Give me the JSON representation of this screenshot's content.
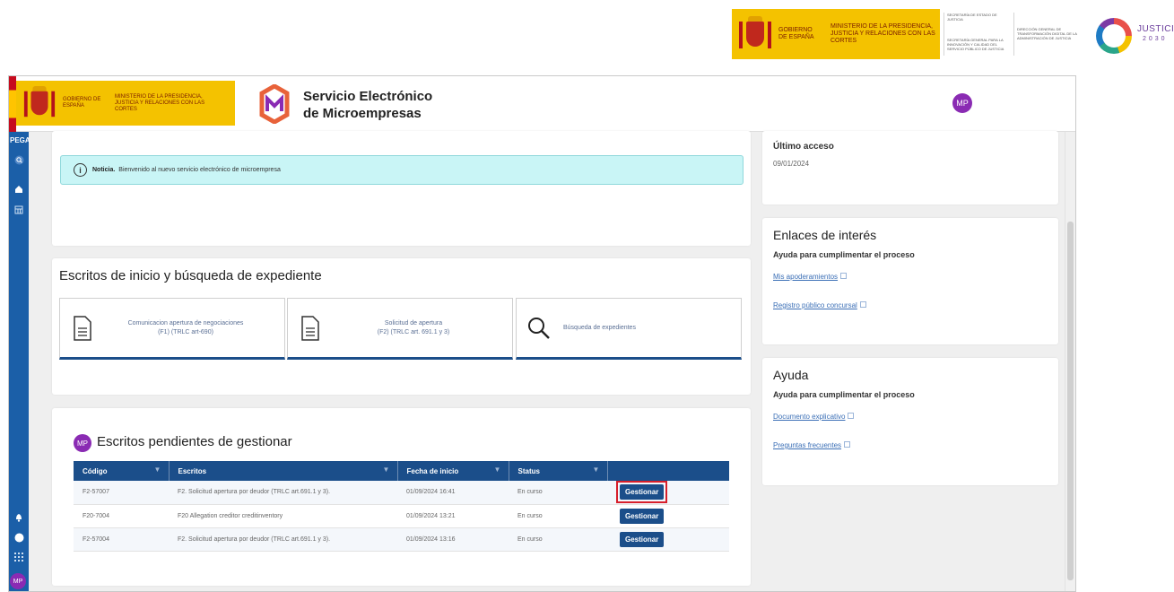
{
  "banner": {
    "gobierno": "GOBIERNO DE ESPAÑA",
    "ministerio": "MINISTERIO DE LA PRESIDENCIA, JUSTICIA Y RELACIONES CON LAS CORTES",
    "secretaria_estado": "SECRETARÍA DE ESTADO DE JUSTICIA",
    "secretaria_general": "SECRETARÍA GENERAL PARA LA INNOVACIÓN Y CALIDAD DEL SERVICIO PÚBLICO DE JUSTICIA",
    "direccion_general": "DIRECCIÓN GENERAL DE TRANSFORMACIÓN DIGITAL DE LA ADMINISTRACIÓN DE JUSTICIA",
    "justicia": "JUSTICIA",
    "justicia_year": "2030"
  },
  "header": {
    "gobierno": "GOBIERNO DE ESPAÑA",
    "ministerio": "MINISTERIO DE LA PRESIDENCIA, JUSTICIA Y RELACIONES CON LAS CORTES",
    "title_line1": "Servicio Electrónico",
    "title_line2": "de Microempresas",
    "avatar": "MP"
  },
  "sidebar": {
    "brand": "PEGA",
    "bottom_avatar": "MP",
    "icons": [
      "search-icon",
      "home-icon",
      "calendar-icon",
      "bell-icon",
      "help-icon",
      "apps-icon"
    ]
  },
  "notice": {
    "icon": "i",
    "label": "Noticia.",
    "text": "Bienvenido al nuevo servicio electrónico de microempresa"
  },
  "escritos": {
    "title": "Escritos de inicio y búsqueda de expediente",
    "tiles": [
      {
        "line1": "Comunicacion apertura de negociaciones",
        "line2": "(F1) (TRLC art-690)"
      },
      {
        "line1": "Solicitud de apertura",
        "line2": "(F2) (TRLC art. 691.1 y 3)"
      },
      {
        "line1": "Búsqueda de expedientes",
        "line2": ""
      }
    ]
  },
  "pendientes": {
    "badge": "MP",
    "title": "Escritos pendientes de gestionar",
    "columns": [
      "Código",
      "Escritos",
      "Fecha de inicio",
      "Status",
      ""
    ],
    "rows": [
      {
        "codigo": "F2-57007",
        "escrito": "F2. Solicitud apertura por deudor (TRLC art.691.1 y 3).",
        "fecha": "01/09/2024 16:41",
        "status": "En curso",
        "action": "Gestionar"
      },
      {
        "codigo": "F20-7004",
        "escrito": "F20 Allegation creditor creditinventory",
        "fecha": "01/09/2024 13:21",
        "status": "En curso",
        "action": "Gestionar"
      },
      {
        "codigo": "F2-57004",
        "escrito": "F2. Solicitud apertura por deudor (TRLC art.691.1 y 3).",
        "fecha": "01/09/2024 13:16",
        "status": "En curso",
        "action": "Gestionar"
      }
    ]
  },
  "right": {
    "ultimo_label": "Último acceso",
    "ultimo_value": "09/01/2024",
    "enlaces_title": "Enlaces de interés",
    "enlaces_sub": "Ayuda para cumplimentar el proceso",
    "enlaces_links": [
      "Mis apoderamientos",
      "Registro público concursal"
    ],
    "ayuda_title": "Ayuda",
    "ayuda_sub": "Ayuda para cumplimentar el proceso",
    "ayuda_links": [
      "Documento explicativo",
      "Preguntas frecuentes"
    ]
  },
  "colors": {
    "primary": "#1b4e8a",
    "sidebar": "#1b5fa8",
    "avatar": "#8a2bb3",
    "notice_bg": "#c9f5f6",
    "gob_yellow": "#f4c200",
    "highlight": "#d71f2b"
  }
}
